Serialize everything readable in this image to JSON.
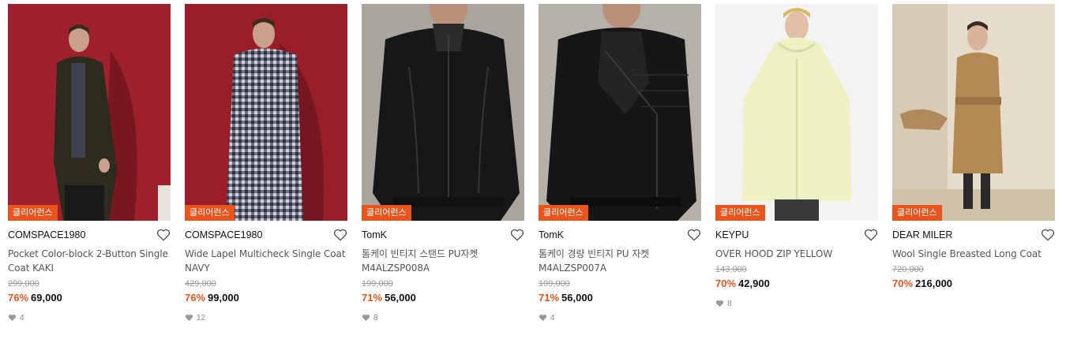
{
  "products": [
    {
      "badge": "클리어런스",
      "brand": "COMSPACE1980",
      "title": "Pocket Color-block 2-Button Single Coat KAKI",
      "original_price": "299,000",
      "discount": "76%",
      "price": "69,000",
      "likes": "4"
    },
    {
      "badge": "클리어런스",
      "brand": "COMSPACE1980",
      "title": "Wide Lapel Multicheck Single Coat NAVY",
      "original_price": "429,000",
      "discount": "76%",
      "price": "99,000",
      "likes": "12"
    },
    {
      "badge": "클리어런스",
      "brand": "TomK",
      "title": "톰케이 빈티지 스탠드 PU자켓 M4ALZSP008A",
      "original_price": "199,000",
      "discount": "71%",
      "price": "56,000",
      "likes": "8"
    },
    {
      "badge": "클리어런스",
      "brand": "TomK",
      "title": "톰케이 경량 빈티지 PU 자켓 M4ALZSP007A",
      "original_price": "199,000",
      "discount": "71%",
      "price": "56,000",
      "likes": "4"
    },
    {
      "badge": "클리어런스",
      "brand": "KEYPU",
      "title": "OVER HOOD ZIP YELLOW",
      "original_price": "143,000",
      "discount": "70%",
      "price": "42,900",
      "likes": "8"
    },
    {
      "badge": "클리어런스",
      "brand": "DEAR MILER",
      "title": "Wool Single Breasted Long Coat",
      "original_price": "720,000",
      "discount": "70%",
      "price": "216,000",
      "likes": ""
    }
  ],
  "colors": {
    "badge": "#e8541b",
    "discount": "#e8541b"
  }
}
